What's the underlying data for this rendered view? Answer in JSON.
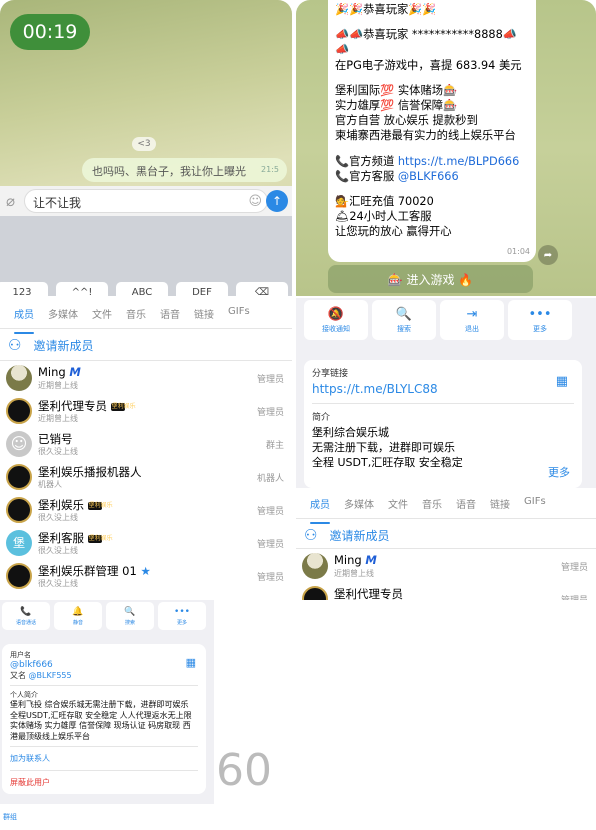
{
  "video": {
    "timer": "00:19",
    "chip": "<3",
    "bubble_text": "也吗吗、黑台子，我让你上曝光",
    "bubble_time": "21:5",
    "input_text": "让不让我",
    "keys": [
      "123",
      "^^!",
      "ABC",
      "DEF",
      "⌫"
    ]
  },
  "promo": {
    "lines": [
      "🎉🎉恭喜玩家🎉🎉",
      "",
      "📣📣恭喜玩家 ***********8888📣",
      "📣",
      "在PG电子游戏中，喜提 683.94 美元",
      "",
      "堡利国际💯 实体赌场🎰",
      "实力雄厚💯 信誉保障🎰",
      "官方自营 放心娱乐 提款秒到",
      "柬埔寨西港最有实力的线上娱乐平台",
      "",
      "📞官方频道 ",
      "📞官方客服 ",
      "",
      "💁汇旺充值 70020",
      "🛎24小时人工客服",
      "让您玩的放心 赢得开心"
    ],
    "channel_link": "https://t.me/BLPD666",
    "service_link": "@BLKF666",
    "time": "01:04",
    "game_button": "🎰 进入游戏 🔥"
  },
  "members": {
    "tabs": [
      "成员",
      "多媒体",
      "文件",
      "音乐",
      "语音",
      "链接",
      "GIFs"
    ],
    "invite": "邀请新成员",
    "rows": [
      {
        "name": "Ming",
        "sub": "近期曾上线",
        "role": "管理员"
      },
      {
        "name": "堡利代理专员",
        "sub": "近期曾上线",
        "role": "管理员"
      },
      {
        "name": "已销号",
        "sub": "很久没上线",
        "role": "群主"
      },
      {
        "name": "堡利娱乐播报机器人",
        "sub": "机器人",
        "role": "机器人"
      },
      {
        "name": "堡利娱乐",
        "sub": "很久没上线",
        "role": "管理员"
      },
      {
        "name": "堡利客服",
        "sub": "很久没上线",
        "role": "管理员"
      },
      {
        "name": "堡利娱乐群管理 01",
        "sub": "很久没上线",
        "role": "管理员"
      }
    ],
    "badge_text": "堡利娱乐",
    "ghost_initial": "堡"
  },
  "group": {
    "actions": [
      "接收通知",
      "搜索",
      "退出",
      "更多"
    ],
    "share_caption": "分享链接",
    "share_link": "https://t.me/BLYLC88",
    "intro_caption": "简介",
    "intro_lines": [
      "堡利综合娱乐城",
      "无需注册下载，进群即可娱乐",
      "全程 USDT,汇旺存取 安全稳定"
    ],
    "more": "更多",
    "tabs": [
      "成员",
      "多媒体",
      "文件",
      "音乐",
      "语音",
      "链接",
      "GIFs"
    ],
    "invite": "邀请新成员",
    "rows": [
      {
        "name": "Ming",
        "sub": "近期曾上线",
        "role": "管理员"
      },
      {
        "name": "堡利代理专员",
        "sub": "",
        "role": "管理员"
      }
    ]
  },
  "profile": {
    "actions": [
      "语音通话",
      "静音",
      "搜索",
      "更多"
    ],
    "username_caption": "用户名",
    "username": "@blkf666",
    "alias_prefix": "又名 ",
    "alias": "@BLKF555",
    "bio_caption": "个人简介",
    "bio": "堡利飞投 综合娱乐城无需注册下载，进群即可娱乐 全程USDT,汇旺存取 安全稳定 人人代理返水无上限 实体赌场 实力雄厚 信誉保障 现场认证 码房取现 西港最顶级线上娱乐平台",
    "add_contact": "加为联系人",
    "block": "屏蔽此用户",
    "footer": "群组"
  },
  "big_number": "60",
  "colors": {
    "accent": "#2b89e5",
    "timer_bg": "#3f8f3a",
    "danger": "#e53935"
  }
}
